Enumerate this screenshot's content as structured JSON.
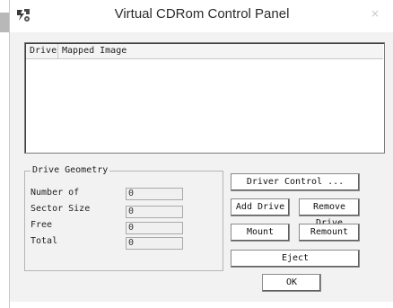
{
  "window": {
    "title": "Virtual CDRom Control Panel",
    "close_glyph": "×",
    "icon": "cdrom-app-icon"
  },
  "list": {
    "columns": [
      "Drive",
      "Mapped Image"
    ],
    "rows": []
  },
  "geometry": {
    "title": "Drive Geometry",
    "fields": [
      {
        "label": "Number of",
        "value": "0"
      },
      {
        "label": "Sector Size",
        "value": "0"
      },
      {
        "label": "Free",
        "value": "0"
      },
      {
        "label": "Total",
        "value": "0"
      }
    ]
  },
  "buttons": {
    "driver_control": "Driver Control ...",
    "add_drive": "Add Drive",
    "remove_drive": "Remove Drive",
    "mount": "Mount",
    "remount": "Remount",
    "eject": "Eject",
    "ok": "OK"
  }
}
